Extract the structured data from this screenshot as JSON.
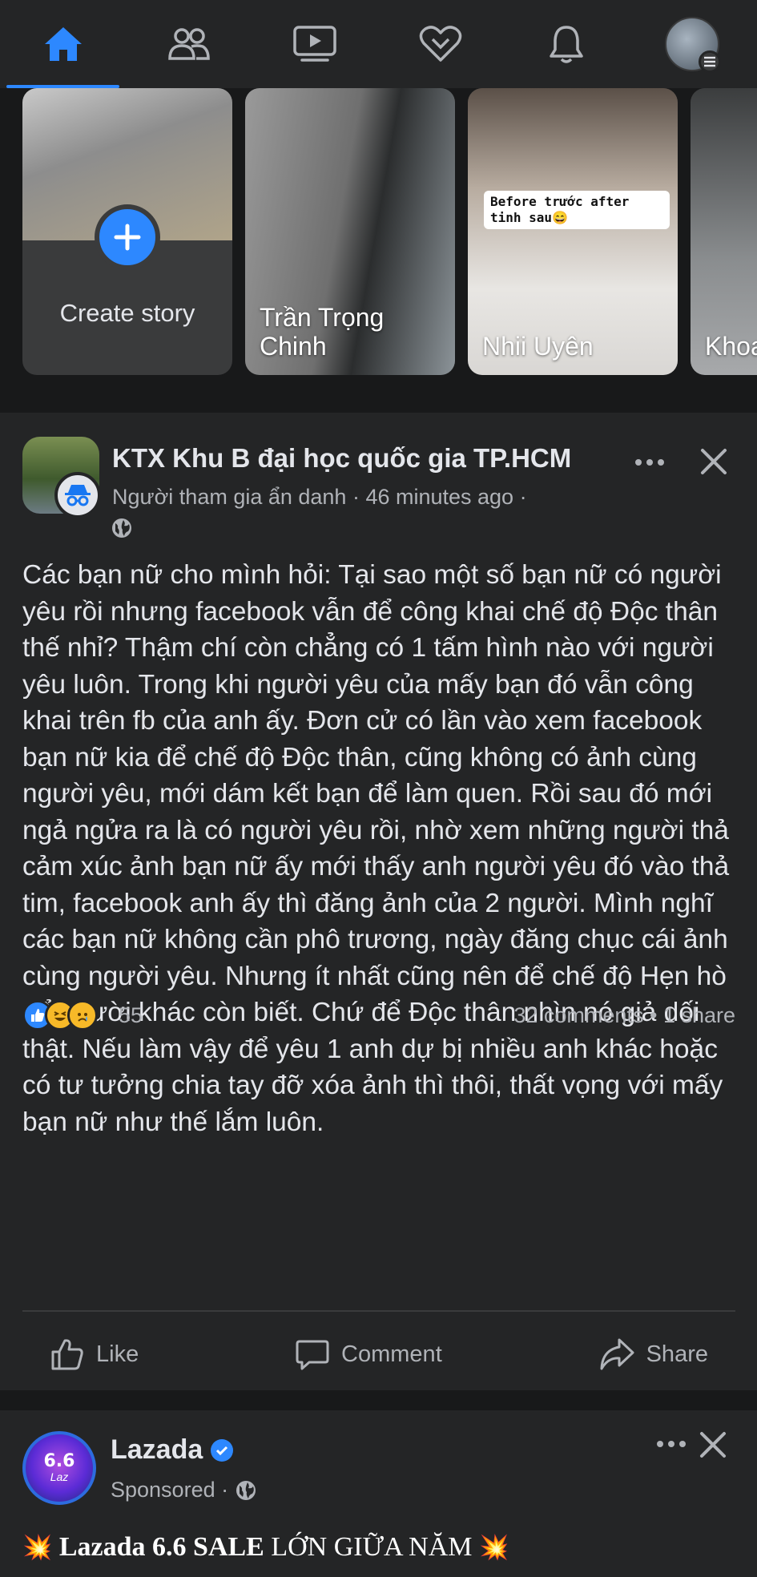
{
  "nav": {
    "items": [
      {
        "name": "home",
        "active": true
      },
      {
        "name": "friends",
        "active": false
      },
      {
        "name": "watch",
        "active": false
      },
      {
        "name": "dating",
        "active": false
      },
      {
        "name": "notifications",
        "active": false
      },
      {
        "name": "menu",
        "active": false
      }
    ]
  },
  "stories": {
    "create_label": "Create story",
    "items": [
      {
        "name": "Trần Trọng Chinh"
      },
      {
        "name": "Nhii Uyên",
        "caption": "Before trước after tinh sau😄"
      },
      {
        "name": "Khoa"
      }
    ]
  },
  "post": {
    "group_name": "KTX Khu B đại học quốc gia TP.HCM",
    "author": "Người tham gia ẩn danh",
    "time": "46 minutes ago",
    "meta_separator": " · ",
    "body": "Các bạn nữ cho mình hỏi: Tại sao một số bạn nữ có người yêu rồi nhưng facebook vẫn để công khai chế độ Độc thân thế nhỉ? Thậm chí còn chẳng có 1 tấm hình nào với người yêu luôn. Trong khi người yêu của mấy bạn đó vẫn công khai trên fb của anh ấy.  Đơn cử có lần vào xem facebook bạn nữ kia để chế độ Độc thân, cũng không có ảnh cùng người yêu, mới dám kết bạn để làm quen. Rồi sau đó mới ngả ngửa ra là có người yêu rồi, nhờ xem những người thả cảm xúc ảnh bạn nữ ấy mới thấy anh người yêu đó vào thả tim, facebook anh ấy thì đăng ảnh của 2 người. Mình nghĩ các bạn nữ không cần phô trương, ngày đăng chục cái ảnh cùng người yêu. Nhưng ít nhất cũng nên để chế độ Hẹn hò để người khác còn biết. Chứ để Độc thân nhìn nó giả dối thật. Nếu làm vậy để yêu 1 anh dự bị nhiều anh khác hoặc có tư tưởng chia tay đỡ xóa ảnh thì thôi, thất vọng với mấy bạn nữ như thế lắm luôn.",
    "reaction_count": "55",
    "comments": "32 comments",
    "shares": "1 share",
    "actions": {
      "like": "Like",
      "comment": "Comment",
      "share": "Share"
    }
  },
  "ad": {
    "name": "Lazada",
    "sponsored": "Sponsored ·",
    "avatar_number": "6.6",
    "avatar_text": "Laz",
    "headline_bold": "Lazada 6.6 SALE",
    "headline_rest": " LỚN GIỮA NĂM"
  },
  "colors": {
    "background": "#18191a",
    "card": "#242526",
    "accent": "#2d88ff",
    "text": "#e4e6eb",
    "secondary_text": "#b0b3b8"
  }
}
